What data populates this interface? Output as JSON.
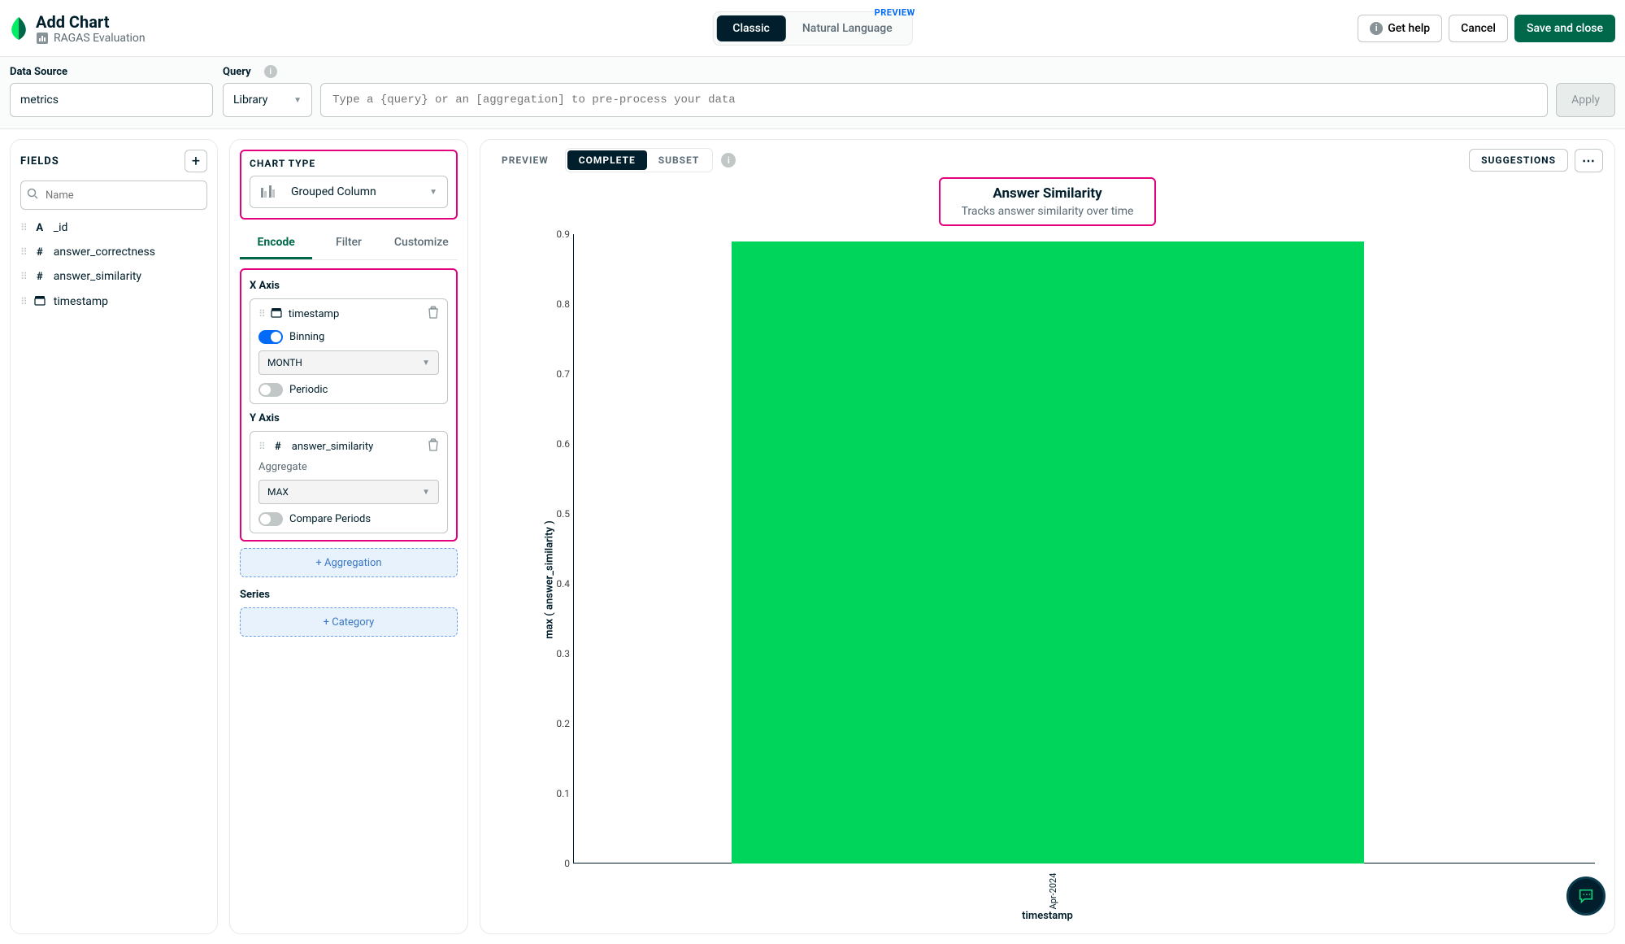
{
  "header": {
    "title": "Add Chart",
    "subtitle": "RAGAS Evaluation",
    "tabs": {
      "classic": "Classic",
      "nl": "Natural Language",
      "preview_badge": "PREVIEW"
    },
    "actions": {
      "help": "Get help",
      "cancel": "Cancel",
      "save": "Save and close"
    }
  },
  "querybar": {
    "data_source_label": "Data Source",
    "data_source_value": "metrics",
    "query_label": "Query",
    "library_label": "Library",
    "query_placeholder": "Type a {query} or an [aggregation] to pre-process your data",
    "apply": "Apply"
  },
  "fields_panel": {
    "heading": "FIELDS",
    "search_placeholder": "Name",
    "items": [
      {
        "type": "A",
        "name": "_id"
      },
      {
        "type": "#",
        "name": "answer_correctness"
      },
      {
        "type": "#",
        "name": "answer_similarity"
      },
      {
        "type": "cal",
        "name": "timestamp"
      }
    ]
  },
  "config": {
    "chart_type_label": "CHART TYPE",
    "chart_type_value": "Grouped Column",
    "tabs": {
      "encode": "Encode",
      "filter": "Filter",
      "customize": "Customize"
    },
    "x": {
      "label": "X Axis",
      "field": "timestamp",
      "binning_label": "Binning",
      "binning_on": true,
      "bin_value": "MONTH",
      "periodic_label": "Periodic",
      "periodic_on": false
    },
    "y": {
      "label": "Y Axis",
      "field": "answer_similarity",
      "aggregate_label": "Aggregate",
      "aggregate_value": "MAX",
      "compare_label": "Compare Periods",
      "compare_on": false
    },
    "add_aggregation": "+ Aggregation",
    "series_label": "Series",
    "add_category": "+ Category"
  },
  "chart": {
    "preview_label": "PREVIEW",
    "complete_label": "COMPLETE",
    "subset_label": "SUBSET",
    "suggestions": "SUGGESTIONS",
    "title": "Answer Similarity",
    "subtitle": "Tracks answer similarity over time",
    "xlabel": "timestamp",
    "ylabel": "max ( answer_similarity )"
  },
  "chart_data": {
    "type": "bar",
    "categories": [
      "Apr-2024"
    ],
    "values": [
      0.89
    ],
    "title": "Answer Similarity",
    "xlabel": "timestamp",
    "ylabel": "max ( answer_similarity )",
    "ylim": [
      0,
      0.9
    ],
    "yticks": [
      0,
      0.1,
      0.2,
      0.3,
      0.4,
      0.5,
      0.6,
      0.7,
      0.8,
      0.9
    ]
  }
}
